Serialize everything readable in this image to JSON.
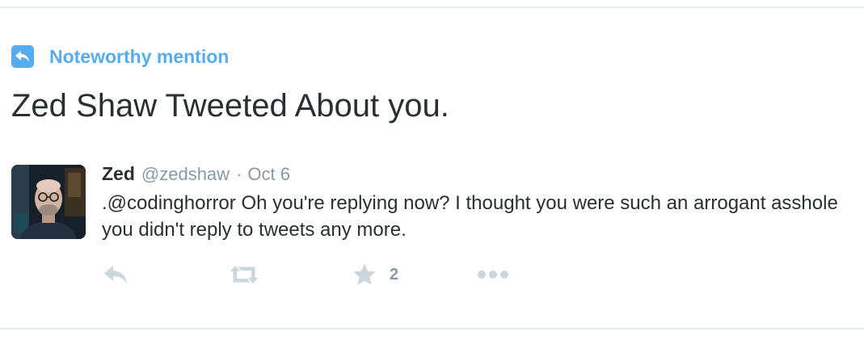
{
  "context": {
    "icon": "reply-arrow-icon",
    "label": "Noteworthy mention"
  },
  "headline": "Zed Shaw Tweeted About you.",
  "tweet": {
    "fullname": "Zed",
    "screen_name": "@zedshaw",
    "separator": "·",
    "timestamp": "Oct 6",
    "text": ".@codinghorror Oh you're replying now? I thought you were such an arrogant asshole you didn't reply to tweets any more.",
    "actions": {
      "reply": {
        "icon": "reply-icon"
      },
      "retweet": {
        "icon": "retweet-icon"
      },
      "favorite": {
        "icon": "star-icon",
        "count": "2"
      },
      "more": {
        "icon": "more-dots-icon"
      }
    }
  },
  "colors": {
    "accent": "#55acee",
    "text": "#292f33",
    "muted": "#8899a6",
    "action_icon": "#ccd6dd",
    "divider": "#e6ecf0"
  }
}
